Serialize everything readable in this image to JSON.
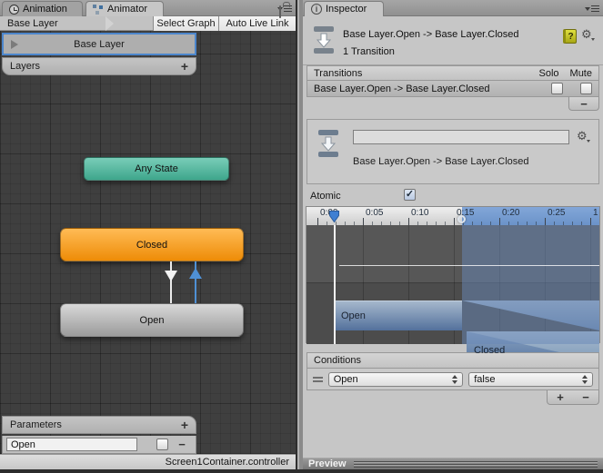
{
  "animator": {
    "tabs": {
      "animation": "Animation",
      "animator": "Animator"
    },
    "breadcrumb": "Base Layer",
    "toolbar": {
      "select_graph": "Select Graph",
      "auto_live_link": "Auto Live Link"
    },
    "layers": {
      "selected_layer": "Base Layer",
      "header": "Layers",
      "add_button": "+"
    },
    "nodes": {
      "any_state": "Any State",
      "closed": "Closed",
      "open": "Open"
    },
    "parameters": {
      "header": "Parameters",
      "add_button": "+",
      "remove_button": "−",
      "rows": [
        {
          "name": "Open",
          "checked": false
        }
      ]
    },
    "status_bar": "Screen1Container.controller"
  },
  "inspector": {
    "tab": "Inspector",
    "header": {
      "title": "Base Layer.Open -> Base Layer.Closed",
      "subtitle": "1 Transition"
    },
    "transitions": {
      "header": "Transitions",
      "solo_label": "Solo",
      "mute_label": "Mute",
      "remove_button": "−",
      "rows": [
        {
          "label": "Base Layer.Open -> Base Layer.Closed",
          "solo": false,
          "mute": false
        }
      ]
    },
    "transition_detail": {
      "name_field": "",
      "label": "Base Layer.Open -> Base Layer.Closed"
    },
    "atomic": {
      "label": "Atomic",
      "checked": true
    },
    "timeline": {
      "ticks": [
        "0:00",
        "0:05",
        "0:10",
        "0:15",
        "0:20",
        "0:25",
        "1"
      ],
      "source_state": "Open",
      "target_state": "Closed",
      "playhead_time": "0:00",
      "transition_start": "0:15"
    },
    "conditions": {
      "header": "Conditions",
      "add_button": "+",
      "remove_button": "−",
      "rows": [
        {
          "parameter": "Open",
          "value": "false"
        }
      ]
    },
    "preview": {
      "label": "Preview"
    }
  },
  "colors": {
    "accent_selection_blue": "#4c86cc",
    "timeline_highlight_blue": "#6b93c9",
    "node_any_state_teal": "#4fb39a",
    "node_default_orange": "#f0930c",
    "node_normal_gray": "#b9b9b9",
    "graph_background": "#3f3f3f",
    "panel_background": "#c6c6c6"
  }
}
